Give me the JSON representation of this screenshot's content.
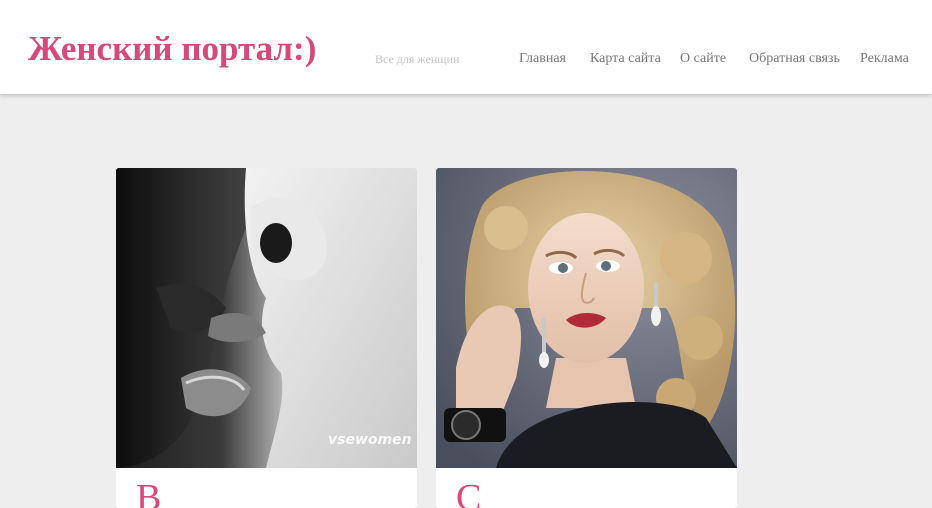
{
  "header": {
    "logo": "Женский портал:)",
    "tagline": "Все для женщин",
    "nav": [
      {
        "label": "Главная"
      },
      {
        "label": "Карта сайта"
      },
      {
        "label": "О сайте"
      },
      {
        "label": "Обратная связь"
      },
      {
        "label": "Реклама"
      }
    ]
  },
  "posts": [
    {
      "title": "В",
      "watermark": "vsewomen"
    },
    {
      "title": "С"
    }
  ],
  "colors": {
    "accent": "#d6497a",
    "nav_text": "#777777",
    "background": "#eeeeee"
  }
}
